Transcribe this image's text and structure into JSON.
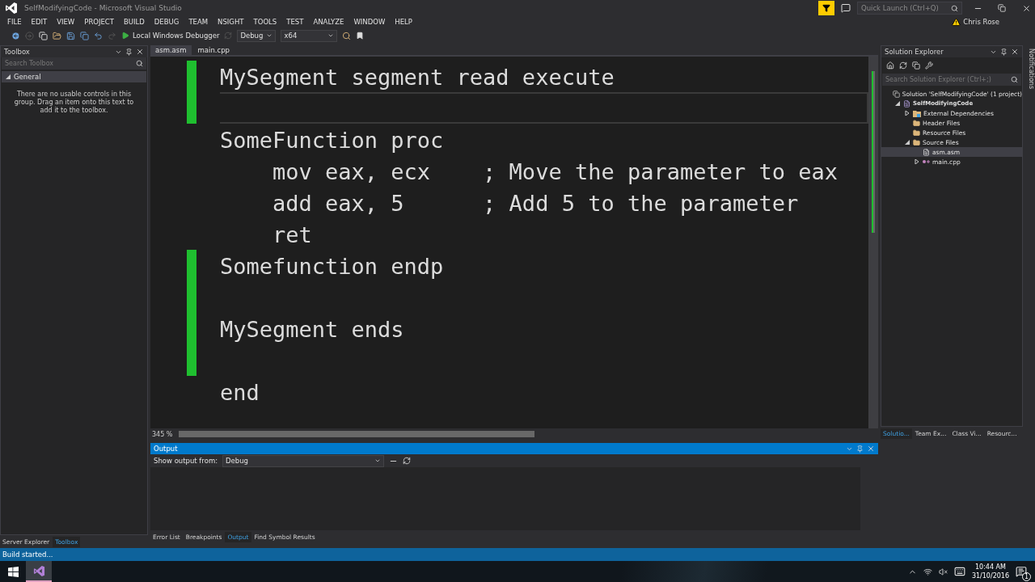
{
  "window": {
    "title": "SelfModifyingCode - Microsoft Visual Studio"
  },
  "menu": [
    "FILE",
    "EDIT",
    "VIEW",
    "PROJECT",
    "BUILD",
    "DEBUG",
    "TEAM",
    "NSIGHT",
    "TOOLS",
    "TEST",
    "ANALYZE",
    "WINDOW",
    "HELP"
  ],
  "toolbar": {
    "debugger": "Local Windows Debugger",
    "configuration": "Debug",
    "platform": "x64"
  },
  "quick_launch": {
    "placeholder": "Quick Launch (Ctrl+Q)"
  },
  "user": {
    "name": "Chris Rose"
  },
  "toolbox": {
    "title": "Toolbox",
    "search_placeholder": "Search Toolbox",
    "group": {
      "label": "General",
      "expanded": true
    },
    "message": "There are no usable controls in this group. Drag an item onto this text to add it to the toolbox."
  },
  "left_tabs": [
    {
      "label": "Server Explorer",
      "selected": false
    },
    {
      "label": "Toolbox",
      "selected": true
    }
  ],
  "editor": {
    "tabs": [
      {
        "label": "asm.asm",
        "selected": true
      },
      {
        "label": "main.cpp",
        "selected": false
      }
    ],
    "lines": [
      {
        "text": "MySegment segment read execute",
        "changed": true,
        "current": false
      },
      {
        "changed": true,
        "current": true
      },
      {
        "text": "SomeFunction proc",
        "changed": false,
        "current": false
      },
      {
        "text": "    mov eax, ecx    ; Move the parameter to eax",
        "changed": false,
        "current": false
      },
      {
        "text": "    add eax, 5      ; Add 5 to the parameter",
        "changed": false,
        "current": false
      },
      {
        "text": "    ret",
        "changed": false,
        "current": false
      },
      {
        "text": "Somefunction endp",
        "changed": true,
        "current": false
      },
      {
        "changed": true,
        "current": false
      },
      {
        "text": "MySegment ends",
        "changed": true,
        "current": false
      },
      {
        "changed": true,
        "current": false
      },
      {
        "text": "end",
        "changed": false,
        "current": false
      }
    ],
    "zoom": "345 %"
  },
  "solution_explorer": {
    "title": "Solution Explorer",
    "search_placeholder": "Search Solution Explorer (Ctrl+;)",
    "tree": [
      {
        "label": "Solution 'SelfModifyingCode' (1 project)",
        "kind": "solution",
        "selected": false,
        "children": [
          {
            "label": "SelfModifyingCode",
            "kind": "project",
            "selected": false,
            "expanded": true,
            "children": [
              {
                "label": "External Dependencies",
                "kind": "deps",
                "selected": false,
                "expanded": false
              },
              {
                "label": "Header Files",
                "kind": "folder",
                "selected": false
              },
              {
                "label": "Resource Files",
                "kind": "folder",
                "selected": false
              },
              {
                "label": "Source Files",
                "kind": "folder",
                "selected": false,
                "expanded": true,
                "children": [
                  {
                    "label": "asm.asm",
                    "kind": "file",
                    "selected": true
                  },
                  {
                    "label": "main.cpp",
                    "kind": "cpp",
                    "selected": false,
                    "expanded": false
                  }
                ]
              }
            ]
          }
        ]
      }
    ]
  },
  "right_tabs": [
    {
      "label": "Solutio...",
      "selected": true
    },
    {
      "label": "Team Ex...",
      "selected": false
    },
    {
      "label": "Class Vi...",
      "selected": false
    },
    {
      "label": "Resourc...",
      "selected": false
    }
  ],
  "notifications": {
    "label": "Notifications"
  },
  "output": {
    "title": "Output",
    "source_label": "Show output from:",
    "source": "Debug"
  },
  "bottom_tabs": [
    {
      "label": "Error List",
      "selected": false
    },
    {
      "label": "Breakpoints",
      "selected": false
    },
    {
      "label": "Output",
      "selected": true
    },
    {
      "label": "Find Symbol Results",
      "selected": false
    }
  ],
  "status_bar": {
    "text": "Build started..."
  },
  "taskbar": {
    "time": "10:44 AM",
    "date": "31/10/2016",
    "notification_count": "1"
  }
}
